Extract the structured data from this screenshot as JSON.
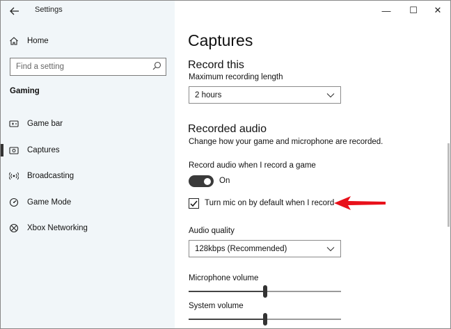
{
  "window": {
    "title": "Settings",
    "back_icon": "arrow-left-icon",
    "controls": {
      "minimize": "—",
      "maximize": "☐",
      "close": "✕"
    }
  },
  "sidebar": {
    "home_label": "Home",
    "search_placeholder": "Find a setting",
    "section_title": "Gaming",
    "items": [
      {
        "label": "Game bar",
        "icon": "game-bar-icon"
      },
      {
        "label": "Captures",
        "icon": "captures-icon",
        "active": true
      },
      {
        "label": "Broadcasting",
        "icon": "broadcasting-icon"
      },
      {
        "label": "Game Mode",
        "icon": "game-mode-icon"
      },
      {
        "label": "Xbox Networking",
        "icon": "xbox-icon"
      }
    ]
  },
  "main": {
    "title": "Captures",
    "record_this": {
      "heading": "Record this",
      "max_length_label": "Maximum recording length",
      "max_length_value": "2 hours"
    },
    "recorded_audio": {
      "heading": "Recorded audio",
      "description": "Change how your game and microphone are recorded.",
      "record_audio_label": "Record audio when I record a game",
      "toggle_state": "On",
      "mic_checkbox_label": "Turn mic on by default when I record",
      "mic_checked": true,
      "audio_quality_label": "Audio quality",
      "audio_quality_value": "128kbps (Recommended)",
      "microphone_volume_label": "Microphone volume",
      "microphone_volume_level": 0.5,
      "system_volume_label": "System volume",
      "system_volume_level": 0.5
    }
  },
  "annotation": {
    "arrow_color": "#e8101a"
  }
}
